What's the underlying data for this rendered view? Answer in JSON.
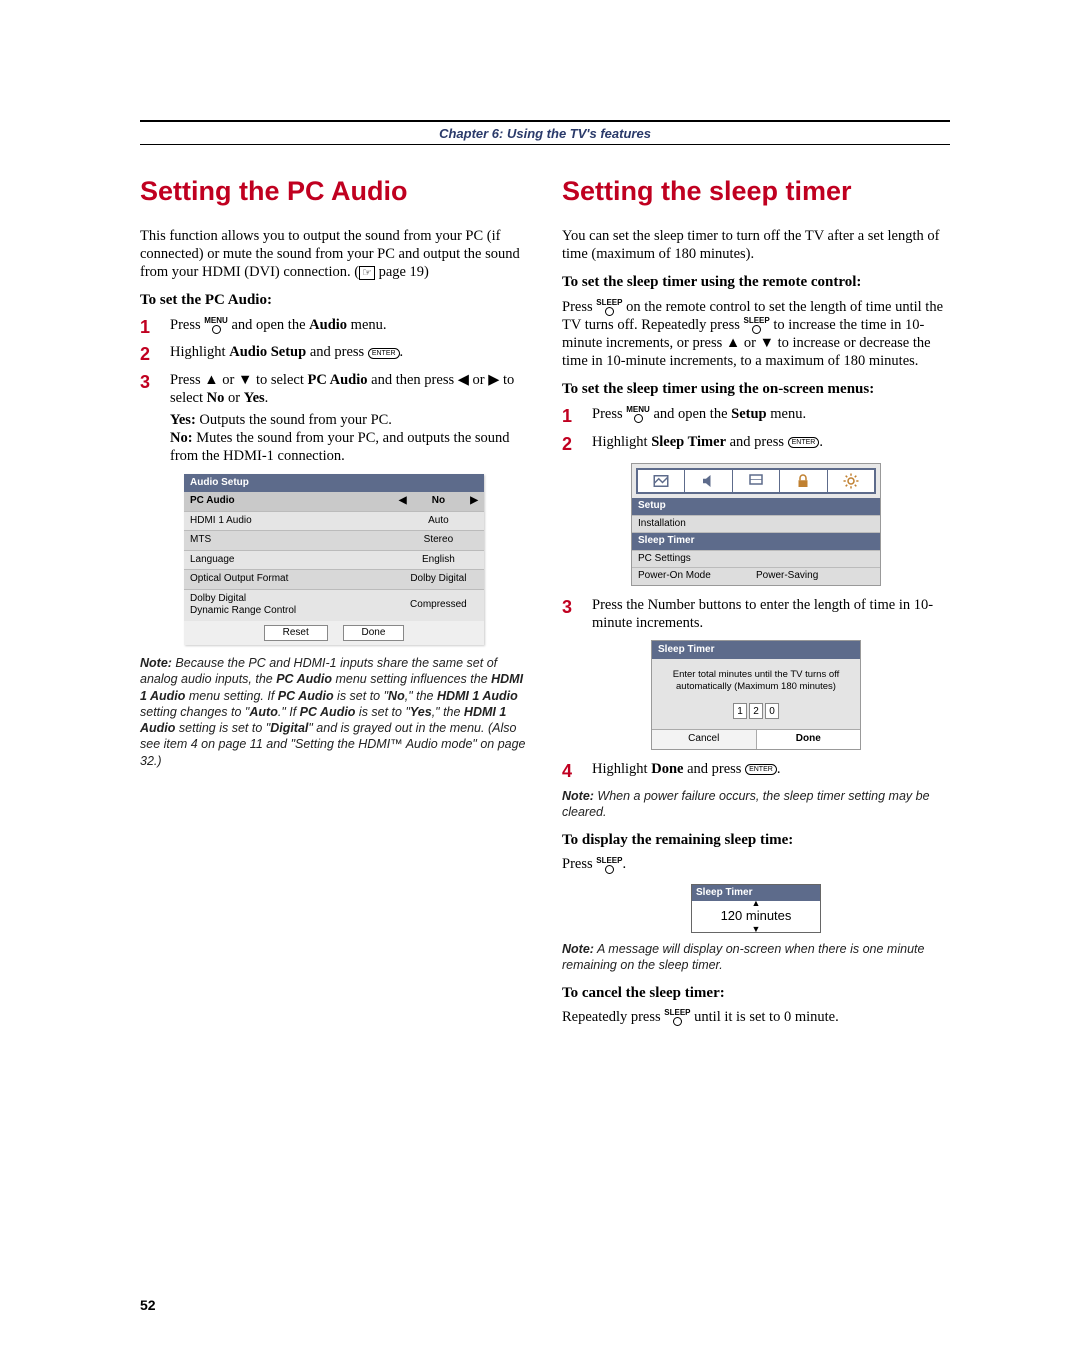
{
  "chapter": "Chapter 6: Using the TV's features",
  "page_number": "52",
  "left": {
    "heading": "Setting the PC Audio",
    "intro": "This function allows you to output the sound from your PC (if connected) or mute the sound from your PC and output the sound from your HDMI (DVI) connection. (",
    "intro_page_ref": " page 19)",
    "subhead": "To set the PC Audio:",
    "step1_a": "Press ",
    "step1_b": " and open the ",
    "step1_menu": "Audio",
    "step1_c": " menu.",
    "menu_btn": "MENU",
    "step2_a": "Highlight ",
    "step2_item": "Audio Setup",
    "step2_b": " and press ",
    "enter_btn": "ENTER",
    "step3_a": "Press ",
    "step3_b": " or ",
    "step3_c": " to select ",
    "step3_item": "PC Audio",
    "step3_d": " and then press ",
    "step3_e": " or ",
    "step3_f": " to select ",
    "step3_no": "No",
    "step3_or": " or ",
    "step3_yes": "Yes",
    "step3_end": ".",
    "yes_label": "Yes:",
    "yes_text": " Outputs the sound from your PC.",
    "no_label": "No:",
    "no_text": " Mutes the sound from your PC, and outputs the sound from the HDMI-1 connection.",
    "table": {
      "title": "Audio Setup",
      "sel_label": "PC Audio",
      "sel_value": "No",
      "rows": [
        {
          "l": "HDMI 1 Audio",
          "v": "Auto"
        },
        {
          "l": "MTS",
          "v": "Stereo"
        },
        {
          "l": "Language",
          "v": "English"
        },
        {
          "l": "Optical Output Format",
          "v": "Dolby Digital"
        },
        {
          "l": "Dolby Digital\nDynamic Range Control",
          "v": "Compressed"
        }
      ],
      "reset": "Reset",
      "done": "Done"
    },
    "note_label": "Note:",
    "note_text_a": " Because the PC and HDMI-1 inputs share the same set of analog audio inputs, the ",
    "note_kw1": "PC Audio",
    "note_text_b": " menu setting influences the ",
    "note_kw2": "HDMI 1 Audio",
    "note_text_c": " menu setting. If ",
    "note_kw3": "PC Audio",
    "note_text_d": " is set to \"",
    "note_kw4": "No",
    "note_text_e": ",\" the ",
    "note_kw5": "HDMI 1 Audio",
    "note_text_f": " setting changes to \"",
    "note_kw6": "Auto",
    "note_text_g": ".\" If ",
    "note_kw7": "PC Audio",
    "note_text_h": " is set to \"",
    "note_kw8": "Yes",
    "note_text_i": ",\" the ",
    "note_kw9": "HDMI 1 Audio",
    "note_text_j": " setting is set to \"",
    "note_kw10": "Digital",
    "note_text_k": "\" and is grayed out in the menu. (Also see item 4 on page 11 and \"Setting the HDMI™ Audio mode\" on page 32.)"
  },
  "right": {
    "heading": "Setting the sleep timer",
    "intro": "You can set the sleep timer to turn off the TV after a set length of time (maximum of 180 minutes).",
    "subhead1": "To set the sleep timer using the remote control:",
    "r1a": "Press ",
    "sleep_btn": "SLEEP",
    "r1b": " on the remote control to set the length of time until the TV turns off. Repeatedly press ",
    "r1c": " to increase the time in 10-minute increments, or press ",
    "r1d": " or ",
    "r1e": " to increase or decrease the time in 10-minute increments, to a maximum of 180 minutes.",
    "subhead2": "To set the sleep timer using the on-screen menus:",
    "step1_a": "Press ",
    "step1_b": " and open the ",
    "step1_menu": "Setup",
    "step1_c": " menu.",
    "menu_btn": "MENU",
    "step2_a": "Highlight ",
    "step2_item": "Sleep Timer",
    "step2_b": " and press ",
    "enter_btn": "ENTER",
    "setup_box": {
      "title": "Setup",
      "rows": [
        "Installation",
        "Sleep Timer",
        "PC Settings"
      ],
      "last_l": "Power-On Mode",
      "last_r": "Power-Saving"
    },
    "step3": "Press the Number buttons to enter the length of time in 10-minute increments.",
    "sleep_box": {
      "title": "Sleep Timer",
      "msg": "Enter total minutes until the TV turns off automatically (Maximum 180 minutes)",
      "d1": "1",
      "d2": "2",
      "d3": "0",
      "cancel": "Cancel",
      "done": "Done"
    },
    "step4_a": "Highlight ",
    "step4_item": "Done",
    "step4_b": " and press ",
    "note1_label": "Note:",
    "note1_text": " When a power failure occurs, the sleep timer setting may be cleared.",
    "subhead3": "To display the remaining sleep time:",
    "disp_a": "Press ",
    "mini_sleep": {
      "title": "Sleep Timer",
      "value": "120 minutes"
    },
    "note2_label": "Note:",
    "note2_text": " A message will display on-screen when there is one minute remaining on the sleep timer.",
    "subhead4": "To cancel the sleep timer:",
    "cancel_a": "Repeatedly press ",
    "cancel_b": " until it is set to 0 minute."
  }
}
